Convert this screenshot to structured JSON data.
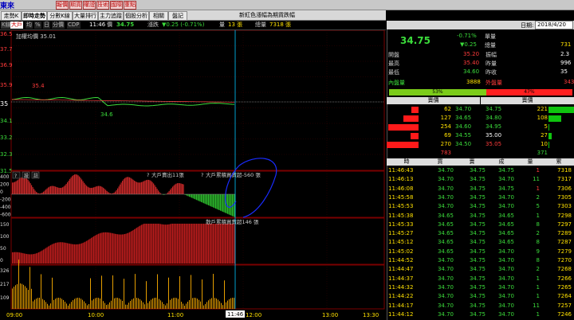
{
  "window": {
    "title": "東來"
  },
  "toolbar": {
    "buttons": [
      "報價",
      "期貨",
      "權證",
      "技術",
      "國際",
      "重點"
    ]
  },
  "tabs": [
    "走勢K線",
    "即時走勢",
    "分數K線",
    "大量排行",
    "主力追蹤",
    "個股分析",
    "相關",
    "盤記"
  ],
  "caption": "新紅色漲幅為期貨跌幅",
  "info": {
    "period": "K線",
    "time_label": "11:46",
    "price_label": "價",
    "price": "34.75",
    "change_label": "漲跌",
    "change": "▼0.25 (-0.71%)",
    "volume_label": "量",
    "volume": "13 張",
    "total_label": "總量",
    "total": "7318 張",
    "modes": [
      "大戶",
      "均",
      "%",
      "日",
      "分價",
      "CDP"
    ]
  },
  "main_chart": {
    "title": "加權均價 35.01",
    "y_labels": [
      "36.5",
      "37.7",
      "36.9",
      "35.9",
      "35",
      "34.1",
      "33.2",
      "32.3",
      "31.5"
    ],
    "annotations": {
      "high": "35.4",
      "low": "34.6"
    }
  },
  "panel2": {
    "label1": "大戶賣出11張",
    "label2": "大戶累積買賣超-560 張",
    "y_labels": [
      "400",
      "200",
      "0",
      "-200",
      "-400",
      "-600"
    ],
    "tags": [
      "?",
      "設",
      "註"
    ]
  },
  "panel3": {
    "label": "散戶累積買賣超146 張",
    "y_labels": [
      "150",
      "100",
      "50",
      "0"
    ]
  },
  "panel4": {
    "y_labels": [
      "326",
      "217",
      "109"
    ]
  },
  "time_axis": {
    "labels": [
      "09:00",
      "10:00",
      "11:00",
      "11:46",
      "12:00",
      "13:00",
      "13:30"
    ]
  },
  "right": {
    "date_label": "日期:",
    "date": "2018/4/20",
    "price": "34.75",
    "pct": "-0.71%",
    "chg": "▼0.25",
    "unit_label": "單量",
    "total_label": "總量",
    "total": "731",
    "stats": [
      {
        "k": "開盤",
        "v": "35.20",
        "k2": "振幅",
        "v2": "2.3"
      },
      {
        "k": "最高",
        "v": "35.40",
        "k2": "昨量",
        "v2": "996"
      },
      {
        "k": "最低",
        "v": "34.60",
        "k2": "昨收",
        "v2": "35"
      }
    ],
    "inner_label": "內盤量",
    "inner": "3888",
    "outer_label": "外盤量",
    "outer": "343",
    "inner_pct": "53%",
    "outer_pct": "47%",
    "depth_headers": [
      "賣價",
      "賣價"
    ],
    "depth": [
      {
        "bv": "62",
        "bp": "34.70",
        "ap": "34.75",
        "av": "221"
      },
      {
        "bv": "127",
        "bp": "34.65",
        "ap": "34.80",
        "av": "108"
      },
      {
        "bv": "254",
        "bp": "34.60",
        "ap": "34.95",
        "av": "5"
      },
      {
        "bv": "69",
        "bp": "34.55",
        "ap": "35.00",
        "av": "27"
      },
      {
        "bv": "270",
        "bp": "34.50",
        "ap": "35.05",
        "av": "10"
      }
    ],
    "depth_totals": [
      "783",
      "371"
    ],
    "ticks_headers": [
      "時",
      "買",
      "賣",
      "成",
      "量",
      "累"
    ],
    "ticks": [
      [
        "11:46:43",
        "34.70",
        "34.75",
        "34.75",
        "1",
        "7318"
      ],
      [
        "11:46:13",
        "34.70",
        "34.75",
        "34.70",
        "11",
        "7317"
      ],
      [
        "11:46:08",
        "34.70",
        "34.75",
        "34.75",
        "1",
        "7306"
      ],
      [
        "11:45:58",
        "34.70",
        "34.75",
        "34.70",
        "2",
        "7305"
      ],
      [
        "11:45:53",
        "34.70",
        "34.75",
        "34.70",
        "5",
        "7303"
      ],
      [
        "11:45:38",
        "34.65",
        "34.75",
        "34.65",
        "1",
        "7298"
      ],
      [
        "11:45:33",
        "34.65",
        "34.75",
        "34.65",
        "8",
        "7297"
      ],
      [
        "11:45:27",
        "34.65",
        "34.75",
        "34.65",
        "2",
        "7289"
      ],
      [
        "11:45:12",
        "34.65",
        "34.75",
        "34.65",
        "8",
        "7287"
      ],
      [
        "11:45:02",
        "34.65",
        "34.75",
        "34.70",
        "9",
        "7279"
      ],
      [
        "11:44:52",
        "34.70",
        "34.75",
        "34.70",
        "8",
        "7270"
      ],
      [
        "11:44:47",
        "34.70",
        "34.75",
        "34.70",
        "2",
        "7268"
      ],
      [
        "11:44:37",
        "34.70",
        "34.75",
        "34.70",
        "1",
        "7266"
      ],
      [
        "11:44:32",
        "34.70",
        "34.75",
        "34.70",
        "1",
        "7265"
      ],
      [
        "11:44:22",
        "34.70",
        "34.75",
        "34.70",
        "1",
        "7264"
      ],
      [
        "11:44:17",
        "34.70",
        "34.75",
        "34.70",
        "11",
        "7257"
      ],
      [
        "11:44:12",
        "34.70",
        "34.75",
        "34.70",
        "1",
        "7246"
      ]
    ]
  },
  "colors": {
    "up": "#ff3b3b",
    "down": "#3bdc3b",
    "accent": "#ffe100"
  }
}
